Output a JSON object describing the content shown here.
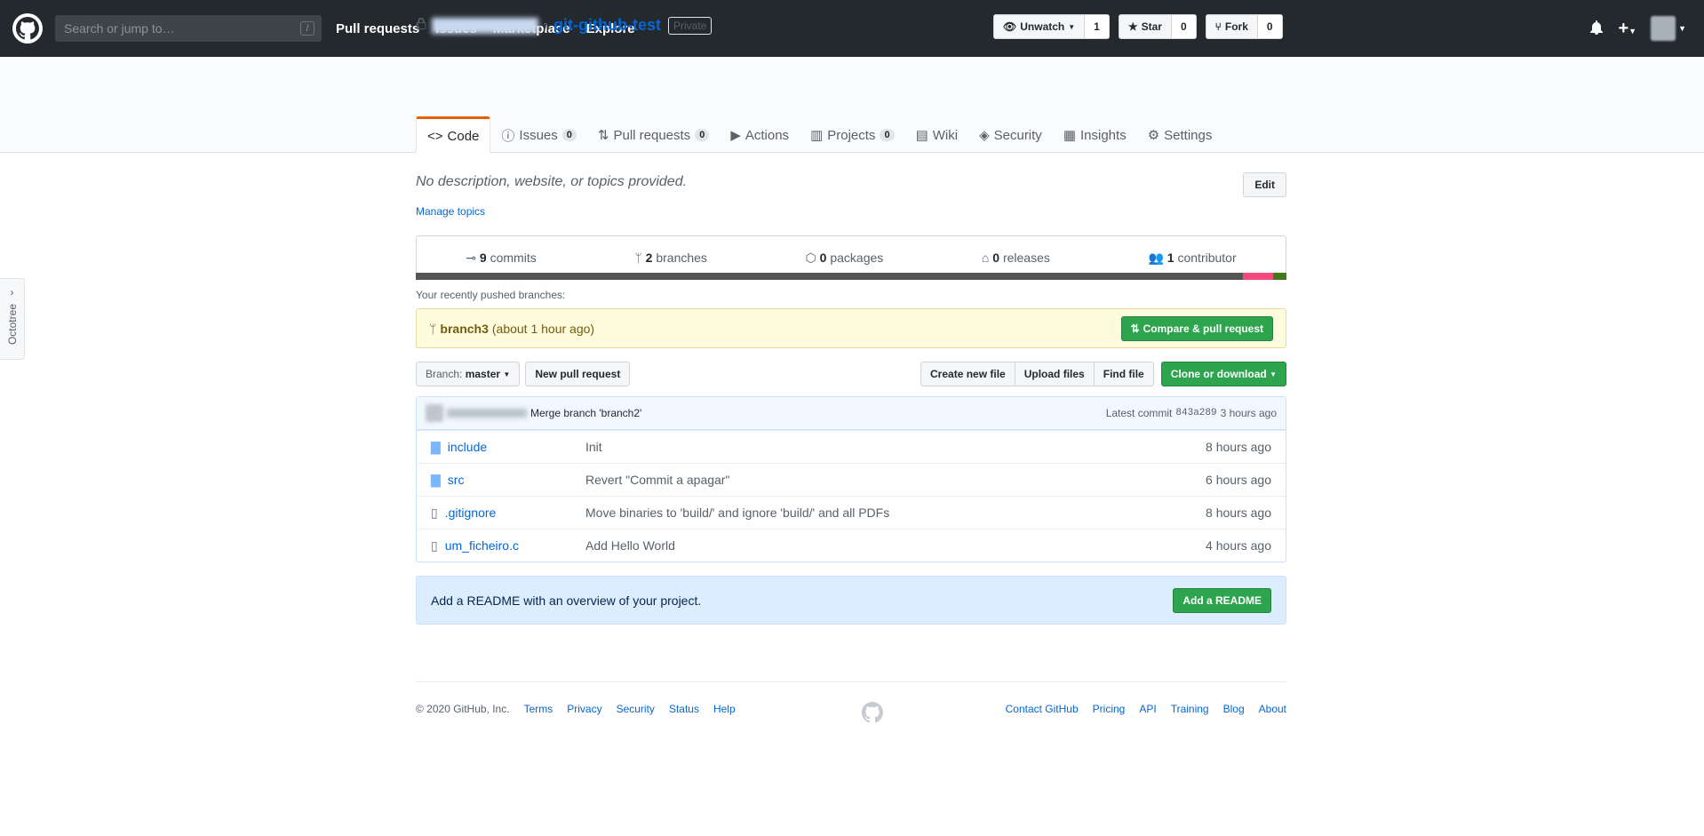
{
  "search": {
    "placeholder": "Search or jump to…",
    "slash": "/"
  },
  "topnav": [
    "Pull requests",
    "Issues",
    "Marketplace",
    "Explore"
  ],
  "repo": {
    "name": "git-github-test",
    "separator": "/",
    "visibility": "Private"
  },
  "actions": {
    "watch": "Unwatch",
    "watch_count": "1",
    "star": "Star",
    "star_count": "0",
    "fork": "Fork",
    "fork_count": "0"
  },
  "tabs": [
    {
      "label": "Code",
      "count": null
    },
    {
      "label": "Issues",
      "count": "0"
    },
    {
      "label": "Pull requests",
      "count": "0"
    },
    {
      "label": "Actions",
      "count": null
    },
    {
      "label": "Projects",
      "count": "0"
    },
    {
      "label": "Wiki",
      "count": null
    },
    {
      "label": "Security",
      "count": null
    },
    {
      "label": "Insights",
      "count": null
    },
    {
      "label": "Settings",
      "count": null
    }
  ],
  "about": {
    "description": "No description, website, or topics provided.",
    "edit": "Edit",
    "manage_topics": "Manage topics"
  },
  "stats": [
    {
      "num": "9",
      "label": "commits"
    },
    {
      "num": "2",
      "label": "branches"
    },
    {
      "num": "0",
      "label": "packages"
    },
    {
      "num": "0",
      "label": "releases"
    },
    {
      "num": "1",
      "label": "contributor"
    }
  ],
  "languages": [
    {
      "color": "#555555",
      "fraction": 0.95
    },
    {
      "color": "#f34b7d",
      "fraction": 0.035
    },
    {
      "color": "#427819",
      "fraction": 0.015
    }
  ],
  "recent": {
    "label": "Your recently pushed branches:",
    "branch": "branch3",
    "time": "(about 1 hour ago)",
    "compare": "Compare & pull request"
  },
  "toolbar": {
    "branch_label": "Branch:",
    "branch": "master",
    "new_pr": "New pull request",
    "create": "Create new file",
    "upload": "Upload files",
    "find": "Find file",
    "clone": "Clone or download"
  },
  "commit": {
    "message": "Merge branch 'branch2'",
    "latest": "Latest commit",
    "sha": "843a289",
    "age": "3 hours ago"
  },
  "files": [
    {
      "name": "include",
      "type": "dir",
      "message": "Init",
      "age": "8 hours ago"
    },
    {
      "name": "src",
      "type": "dir",
      "message": "Revert \"Commit a apagar\"",
      "age": "6 hours ago"
    },
    {
      "name": ".gitignore",
      "type": "file",
      "message": "Move binaries to 'build/' and ignore 'build/' and all PDFs",
      "age": "8 hours ago"
    },
    {
      "name": "um_ficheiro.c",
      "type": "file",
      "message": "Add Hello World",
      "age": "4 hours ago"
    }
  ],
  "readme": {
    "text": "Add a README with an overview of your project.",
    "button": "Add a README"
  },
  "footer": {
    "copyright": "© 2020 GitHub, Inc.",
    "left_links": [
      "Terms",
      "Privacy",
      "Security",
      "Status",
      "Help"
    ],
    "right_links": [
      "Contact GitHub",
      "Pricing",
      "API",
      "Training",
      "Blog",
      "About"
    ]
  },
  "octotree": "Octotree"
}
